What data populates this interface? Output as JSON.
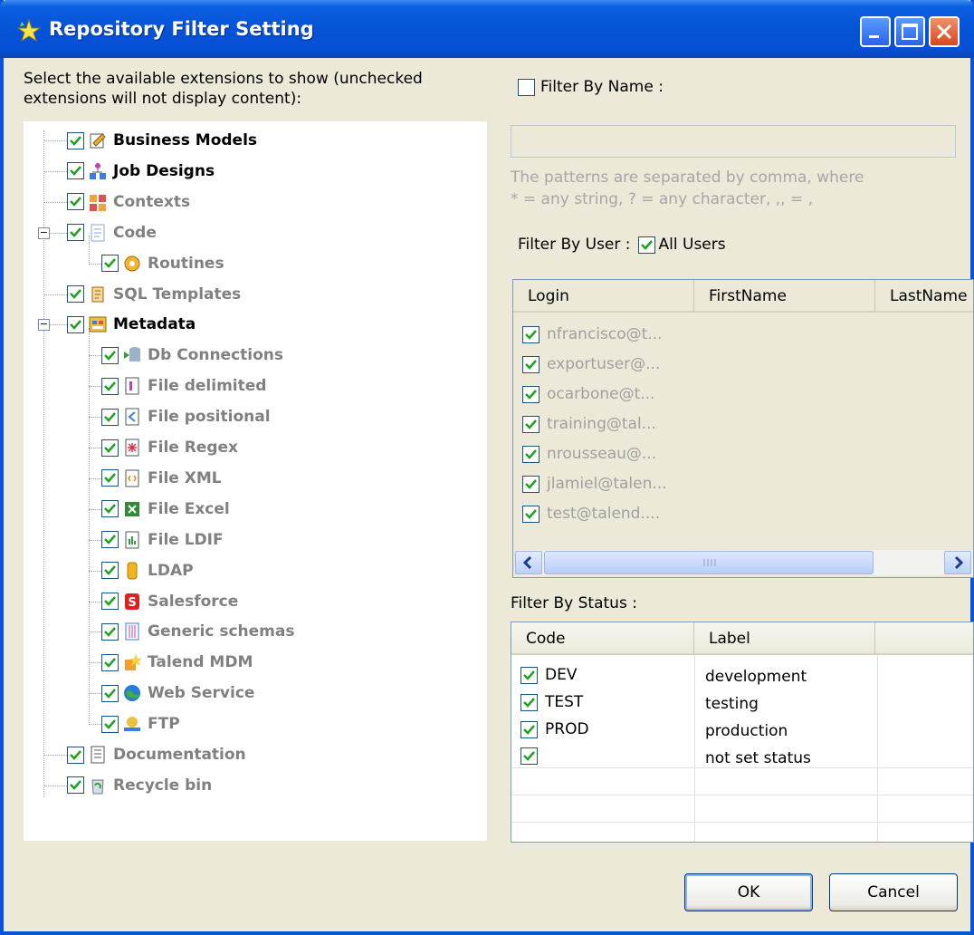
{
  "window": {
    "title": "Repository Filter Setting"
  },
  "tree": {
    "instructions": "Select the available extensions to show (unchecked extensions will not display content):",
    "items": [
      {
        "label": "Business Models",
        "icon": "business-models-icon",
        "checked": true,
        "strong": true
      },
      {
        "label": "Job Designs",
        "icon": "job-designs-icon",
        "checked": true,
        "strong": true
      },
      {
        "label": "Contexts",
        "icon": "contexts-icon",
        "checked": true,
        "strong": false
      },
      {
        "label": "Code",
        "icon": "code-icon",
        "checked": true,
        "strong": false,
        "expanded": true
      },
      {
        "label": "Routines",
        "icon": "routines-icon",
        "checked": true,
        "strong": false
      },
      {
        "label": "SQL Templates",
        "icon": "sql-templates-icon",
        "checked": true,
        "strong": false
      },
      {
        "label": "Metadata",
        "icon": "metadata-icon",
        "checked": true,
        "strong": true,
        "expanded": true
      },
      {
        "label": "Db Connections",
        "icon": "db-connections-icon",
        "checked": true,
        "strong": false
      },
      {
        "label": "File delimited",
        "icon": "file-delimited-icon",
        "checked": true,
        "strong": false
      },
      {
        "label": "File positional",
        "icon": "file-positional-icon",
        "checked": true,
        "strong": false
      },
      {
        "label": "File Regex",
        "icon": "file-regex-icon",
        "checked": true,
        "strong": false
      },
      {
        "label": "File XML",
        "icon": "file-xml-icon",
        "checked": true,
        "strong": false
      },
      {
        "label": "File Excel",
        "icon": "file-excel-icon",
        "checked": true,
        "strong": false
      },
      {
        "label": "File LDIF",
        "icon": "file-ldif-icon",
        "checked": true,
        "strong": false
      },
      {
        "label": "LDAP",
        "icon": "ldap-icon",
        "checked": true,
        "strong": false
      },
      {
        "label": "Salesforce",
        "icon": "salesforce-icon",
        "checked": true,
        "strong": false
      },
      {
        "label": "Generic schemas",
        "icon": "generic-schemas-icon",
        "checked": true,
        "strong": false
      },
      {
        "label": "Talend MDM",
        "icon": "talend-mdm-icon",
        "checked": true,
        "strong": false
      },
      {
        "label": "Web Service",
        "icon": "web-service-icon",
        "checked": true,
        "strong": false
      },
      {
        "label": "FTP",
        "icon": "ftp-icon",
        "checked": true,
        "strong": false
      },
      {
        "label": "Documentation",
        "icon": "documentation-icon",
        "checked": true,
        "strong": false
      },
      {
        "label": "Recycle bin",
        "icon": "recycle-bin-icon",
        "checked": true,
        "strong": false
      }
    ]
  },
  "filter_by_name": {
    "label": "Filter By Name :",
    "checked": false,
    "value": "",
    "hint_line1": "The patterns are separated by comma, where",
    "hint_line2": "* = any string, ? = any character, ,, = ,"
  },
  "filter_by_user": {
    "label": "Filter By User :",
    "all_users_label": "All Users",
    "all_users_checked": true,
    "columns": [
      "Login",
      "FirstName",
      "LastName"
    ],
    "rows": [
      {
        "login": "nfrancisco@t...",
        "checked": true
      },
      {
        "login": "exportuser@...",
        "checked": true
      },
      {
        "login": "ocarbone@t...",
        "checked": true
      },
      {
        "login": "training@tal...",
        "checked": true
      },
      {
        "login": "nrousseau@...",
        "checked": true
      },
      {
        "login": "jlamiel@talen...",
        "checked": true
      },
      {
        "login": "test@talend....",
        "checked": true
      }
    ]
  },
  "filter_by_status": {
    "label": "Filter By Status :",
    "columns": [
      "Code",
      "Label"
    ],
    "rows": [
      {
        "code": "DEV",
        "label": "development",
        "checked": true
      },
      {
        "code": "TEST",
        "label": "testing",
        "checked": true
      },
      {
        "code": "PROD",
        "label": "production",
        "checked": true
      },
      {
        "code": "",
        "label": "not set status",
        "checked": true
      }
    ]
  },
  "buttons": {
    "ok": "OK",
    "cancel": "Cancel"
  }
}
